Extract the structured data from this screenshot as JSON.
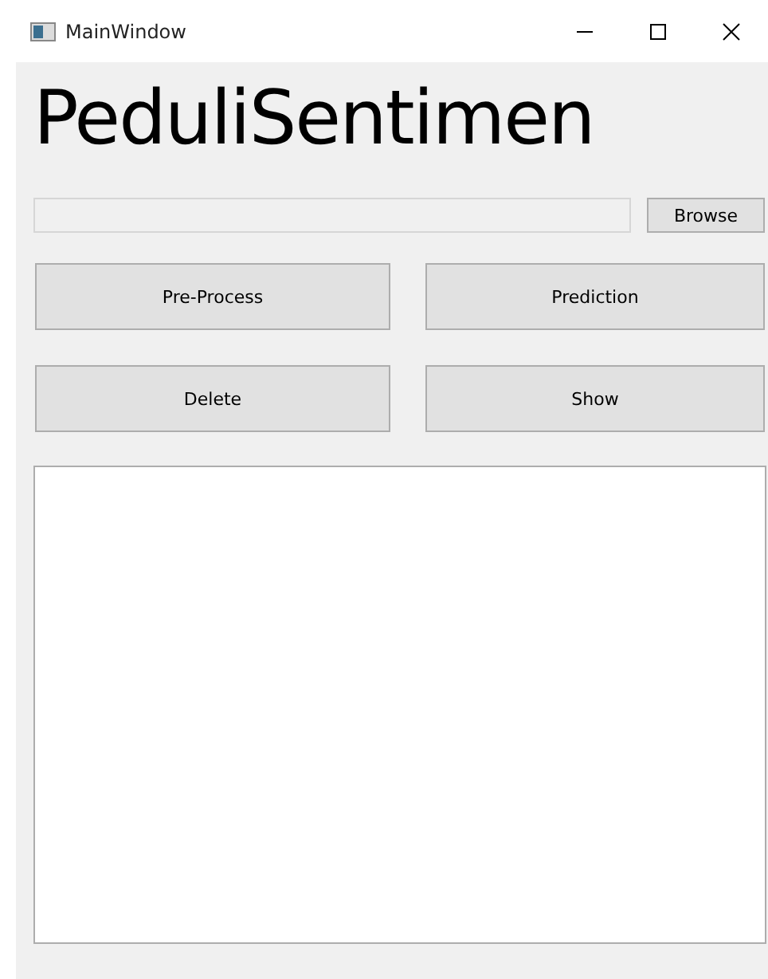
{
  "window": {
    "title": "MainWindow"
  },
  "heading": "PeduliSentimen",
  "browse_button": "Browse",
  "buttons": [
    "Pre-Process",
    "Prediction",
    "Delete",
    "Show"
  ]
}
